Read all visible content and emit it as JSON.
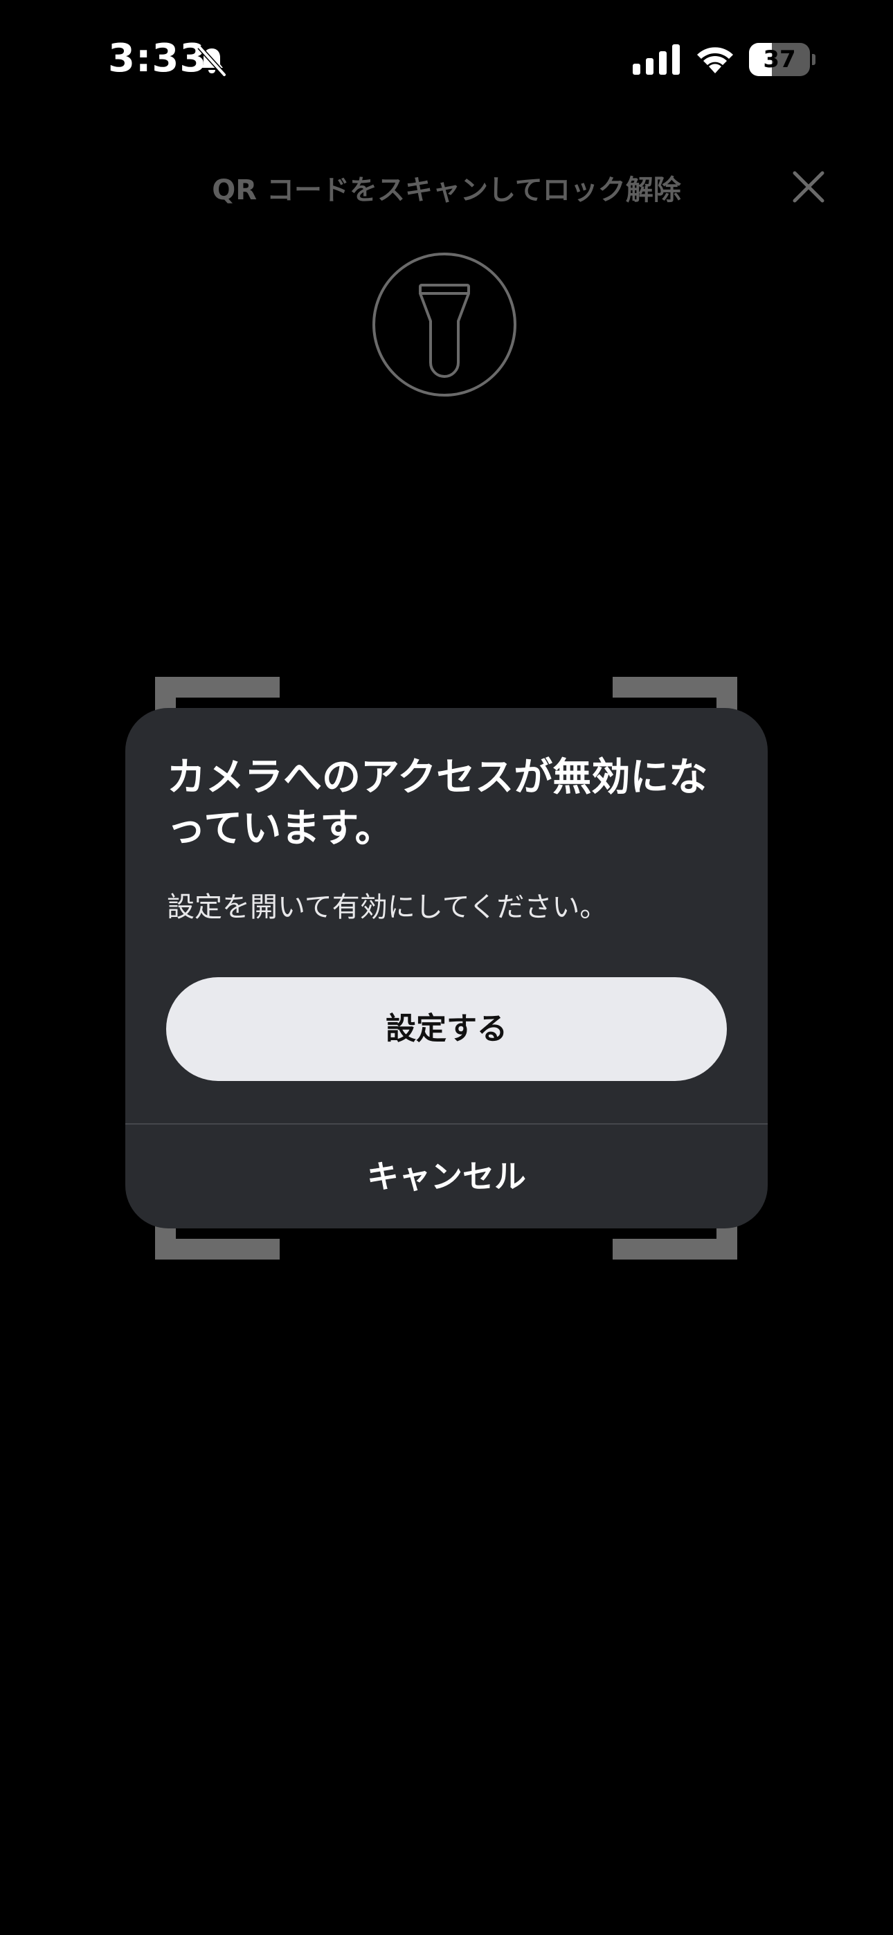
{
  "status_bar": {
    "time": "3:33",
    "battery_level": "37",
    "battery_fraction": 0.37,
    "icons": [
      "bell-slash-icon",
      "cellular-signal-icon",
      "wifi-icon",
      "battery-icon"
    ]
  },
  "header": {
    "title": "QR コードをスキャンしてロック解除",
    "close_icon": "close-icon"
  },
  "flashlight": {
    "icon": "flashlight-icon"
  },
  "dialog": {
    "title": "カメラへのアクセスが無効になっています。",
    "message": "設定を開いて有効にしてください。",
    "primary_button_label": "設定する",
    "cancel_button_label": "キャンセル"
  },
  "colors": {
    "background": "#000000",
    "dialog_background": "#2a2c30",
    "primary_button_background": "#e9eaee",
    "scan_frame": "#6b6b6b",
    "header_text": "#5e5e5e"
  }
}
